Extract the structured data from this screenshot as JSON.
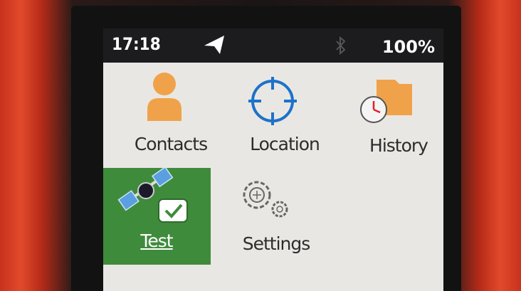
{
  "status_bar": {
    "time": "17:18",
    "battery": "100%",
    "nav_icon": "navigation-arrow-icon",
    "bluetooth_icon": "bluetooth-icon"
  },
  "menu": {
    "items": [
      {
        "label": "Contacts",
        "icon": "person-icon",
        "selected": false
      },
      {
        "label": "Location",
        "icon": "crosshair-icon",
        "selected": false
      },
      {
        "label": "History",
        "icon": "folder-clock-icon",
        "selected": false
      },
      {
        "label": "Test",
        "icon": "satellite-check-icon",
        "selected": true
      },
      {
        "label": "Settings",
        "icon": "gears-icon",
        "selected": false
      }
    ]
  },
  "colors": {
    "accent_orange": "#f0a24a",
    "accent_blue": "#1d72c9",
    "selection_green": "#3f8b3c",
    "device_red": "#d93c22",
    "status_bar": "#1c1c1f"
  }
}
